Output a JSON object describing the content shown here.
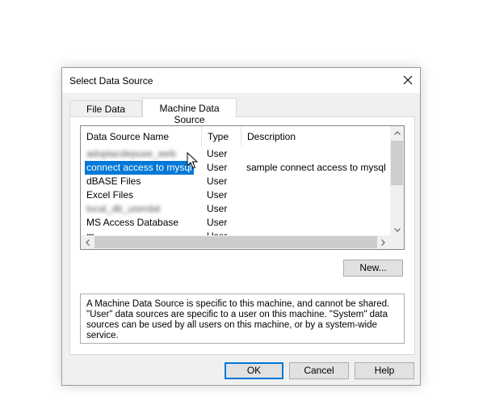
{
  "dialog": {
    "title": "Select Data Source",
    "tabs": [
      {
        "label": "File Data Source",
        "active": false
      },
      {
        "label": "Machine Data Source",
        "active": true
      }
    ],
    "list": {
      "columns": [
        "Data Source Name",
        "Type",
        "Description"
      ],
      "rows": [
        {
          "name": "adoptacdepuse_web",
          "type": "User",
          "description": "",
          "blurred": true
        },
        {
          "name": "connect access to mysql",
          "type": "User",
          "description": "sample connect access to mysql",
          "selected": true
        },
        {
          "name": "dBASE Files",
          "type": "User",
          "description": ""
        },
        {
          "name": "Excel Files",
          "type": "User",
          "description": ""
        },
        {
          "name": "local_db_userdat",
          "type": "User",
          "description": "",
          "blurred": true
        },
        {
          "name": "MS Access Database",
          "type": "User",
          "description": ""
        },
        {
          "name": "m",
          "type": "User",
          "description": ""
        }
      ]
    },
    "new_button": "New...",
    "info_text": "A Machine Data Source is specific to this machine, and cannot be shared. \"User\" data sources are specific to a user on this machine.  \"System\" data sources can be used by all users on this machine, or by a system-wide service.",
    "buttons": {
      "ok": "OK",
      "cancel": "Cancel",
      "help": "Help"
    },
    "colors": {
      "selection": "#0078d7",
      "default_button_border": "#0078d7",
      "dialog_bg": "#f0f0f0"
    }
  }
}
